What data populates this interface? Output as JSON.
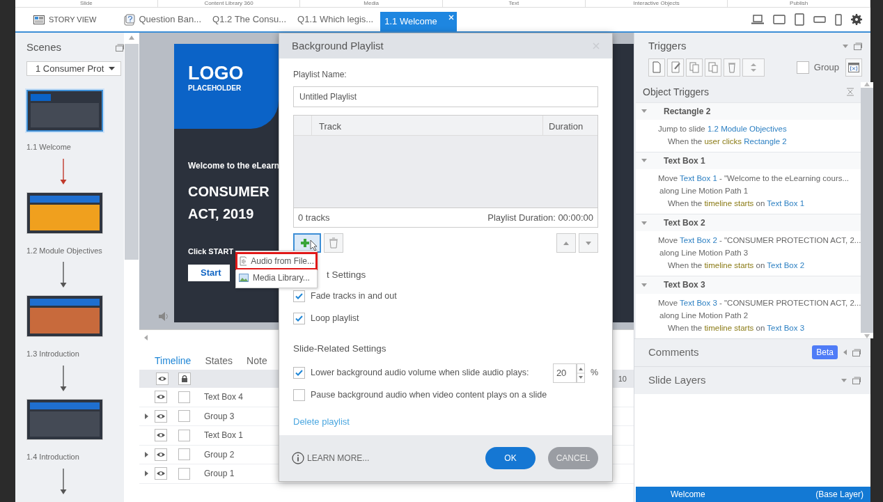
{
  "ribbon": [
    "Slide",
    "Content Library 360",
    "Media",
    "Text",
    "Interactive Objects",
    "Publish"
  ],
  "tabbar": {
    "story_view": "STORY VIEW",
    "tabs": [
      {
        "label": "Question Ban...",
        "kind": "question",
        "selected": false
      },
      {
        "label": "Q1.2 The Consu...",
        "kind": "plain",
        "selected": false
      },
      {
        "label": "Q1.1 Which legis...",
        "kind": "plain",
        "selected": false
      },
      {
        "label": "1.1 Welcome",
        "kind": "plain",
        "selected": true
      }
    ]
  },
  "scenes": {
    "title": "Scenes",
    "scene": "1 Consumer Prot",
    "slides": [
      {
        "label": "1.1 Welcome",
        "selected": true
      },
      {
        "label": "1.2 Module Objectives",
        "selected": false
      },
      {
        "label": "1.3 Introduction",
        "selected": false
      },
      {
        "label": "1.4 Introduction",
        "selected": false
      }
    ]
  },
  "stage": {
    "logo": "LOGO",
    "logo_sub": "PLACEHOLDER",
    "welcome": "Welcome to the eLearn",
    "title_lines": [
      "CONSUMER",
      "ACT, 2019"
    ],
    "prompt": "Click START",
    "start": "Start"
  },
  "timeline": {
    "tabs": [
      {
        "label": "Timeline",
        "selected": true
      },
      {
        "label": "States",
        "selected": false
      },
      {
        "label": "Note",
        "selected": false
      }
    ],
    "ruler_label": "10",
    "rows": [
      {
        "name": "Text Box 4",
        "expandable": false,
        "locked": false
      },
      {
        "name": "Group 3",
        "expandable": true,
        "locked": false
      },
      {
        "name": "Text Box 1",
        "expandable": false,
        "locked": false
      },
      {
        "name": "Group 2",
        "expandable": true,
        "locked": false
      },
      {
        "name": "Group 1",
        "expandable": true,
        "locked": false
      }
    ]
  },
  "dialog": {
    "title": "Background Playlist",
    "name_label": "Playlist Name:",
    "name_value": "Untitled Playlist",
    "columns": [
      "Track",
      "Duration"
    ],
    "track_count": "0 tracks",
    "duration": "Playlist Duration: 00:00:00",
    "playlist_heading": "t Settings",
    "playlist_options": [
      {
        "label": "Fade tracks in and out",
        "checked": true
      },
      {
        "label": "Loop playlist",
        "checked": true
      }
    ],
    "slide_heading": "Slide-Related Settings",
    "slide_options": [
      {
        "label": "Lower background audio volume when slide audio plays:",
        "checked": true,
        "kind": "spin",
        "value": "20",
        "unit": "%"
      },
      {
        "label": "Pause background audio when video content plays on a slide",
        "checked": false,
        "kind": "plain"
      }
    ],
    "delete": "Delete playlist",
    "learn_more": "LEARN MORE...",
    "ok": "OK",
    "cancel": "CANCEL"
  },
  "add_menu": {
    "items": [
      {
        "label": "Audio from File...",
        "highlighted": true
      },
      {
        "label": "Media Library...",
        "highlighted": false
      }
    ]
  },
  "triggers": {
    "title": "Triggers",
    "group_label": "Group",
    "group_checked": false,
    "section": "Object Triggers",
    "items": [
      {
        "object": "Rectangle 2",
        "expanded": true,
        "action": [
          [
            {
              "text": "Jump to slide ",
              "kind": "plain"
            },
            {
              "text": "1.2 Module Objectives",
              "kind": "link"
            }
          ]
        ],
        "condition": [
          {
            "text": "When the ",
            "kind": "plain"
          },
          {
            "text": "user clicks ",
            "kind": "event"
          },
          {
            "text": "Rectangle 2",
            "kind": "link"
          }
        ]
      },
      {
        "object": "Text Box 1",
        "expanded": true,
        "action": [
          [
            {
              "text": "Move ",
              "kind": "plain"
            },
            {
              "text": "Text Box 1",
              "kind": "link"
            },
            {
              "text": " - \"Welcome to the eLearning cours...",
              "kind": "plain"
            }
          ],
          [
            {
              "text": "along Line Motion Path 1",
              "kind": "plain"
            }
          ]
        ],
        "condition": [
          {
            "text": "When the ",
            "kind": "plain"
          },
          {
            "text": "timeline starts",
            "kind": "event"
          },
          {
            "text": " on ",
            "kind": "plain"
          },
          {
            "text": "Text Box 1",
            "kind": "link"
          }
        ]
      },
      {
        "object": "Text Box 2",
        "expanded": true,
        "action": [
          [
            {
              "text": "Move ",
              "kind": "plain"
            },
            {
              "text": "Text Box 2",
              "kind": "link"
            },
            {
              "text": " - \"CONSUMER PROTECTION ACT, 2...",
              "kind": "plain"
            }
          ],
          [
            {
              "text": "along Line Motion Path 3",
              "kind": "plain"
            }
          ]
        ],
        "condition": [
          {
            "text": "When the ",
            "kind": "plain"
          },
          {
            "text": "timeline starts",
            "kind": "event"
          },
          {
            "text": " on ",
            "kind": "plain"
          },
          {
            "text": "Text Box 2",
            "kind": "link"
          }
        ]
      },
      {
        "object": "Text Box 3",
        "expanded": true,
        "action": [
          [
            {
              "text": "Move ",
              "kind": "plain"
            },
            {
              "text": "Text Box 3",
              "kind": "link"
            },
            {
              "text": " - \"CONSUMER PROTECTION ACT, 2...",
              "kind": "plain"
            }
          ],
          [
            {
              "text": "along Line Motion Path 2",
              "kind": "plain"
            }
          ]
        ],
        "condition": [
          {
            "text": "When the ",
            "kind": "plain"
          },
          {
            "text": "timeline starts",
            "kind": "event"
          },
          {
            "text": " on ",
            "kind": "plain"
          },
          {
            "text": "Text Box 3",
            "kind": "link"
          }
        ]
      }
    ]
  },
  "comments": {
    "title": "Comments",
    "badge": "Beta"
  },
  "slide_layers": {
    "title": "Slide Layers",
    "layers": [
      {
        "name": "Welcome",
        "note": "(Base Layer)",
        "selected": true
      }
    ]
  }
}
